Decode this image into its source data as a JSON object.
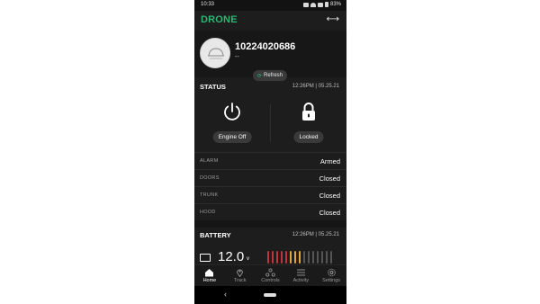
{
  "status_bar": {
    "time": "10:33",
    "battery": "83%"
  },
  "app": {
    "logo": "DRONE",
    "swap_icon": "swap-arrows-icon"
  },
  "vehicle": {
    "id": "10224020686",
    "subtitle": "--"
  },
  "refresh": {
    "label": "Refresh"
  },
  "status": {
    "title": "STATUS",
    "timestamp": "12:26PM | 05.25.21",
    "engine": {
      "label": "Engine Off",
      "icon": "power-icon"
    },
    "lock": {
      "label": "Locked",
      "icon": "lock-icon"
    },
    "rows": [
      {
        "label": "ALARM",
        "value": "Armed"
      },
      {
        "label": "DOORS",
        "value": "Closed"
      },
      {
        "label": "TRUNK",
        "value": "Closed"
      },
      {
        "label": "HOOD",
        "value": "Closed"
      }
    ]
  },
  "battery": {
    "title": "BATTERY",
    "timestamp": "12:26PM | 05.25.21",
    "voltage": "12.0",
    "unit": "v",
    "level_bars": [
      "#c0343d",
      "#c0343d",
      "#c0343d",
      "#c0343d",
      "#c0343d",
      "#e3a43a",
      "#e3a43a",
      "#e3a43a",
      "#555555",
      "#555555",
      "#555555",
      "#555555",
      "#555555",
      "#555555",
      "#555555"
    ]
  },
  "tabs": [
    {
      "label": "Home",
      "icon": "home-icon",
      "active": true
    },
    {
      "label": "Track",
      "icon": "map-pin-icon",
      "active": false
    },
    {
      "label": "Controls",
      "icon": "controls-icon",
      "active": false
    },
    {
      "label": "Activity",
      "icon": "list-icon",
      "active": false
    },
    {
      "label": "Settings",
      "icon": "gear-icon",
      "active": false
    }
  ],
  "colors": {
    "brand": "#2bb673",
    "background": "#1d1d1d"
  }
}
